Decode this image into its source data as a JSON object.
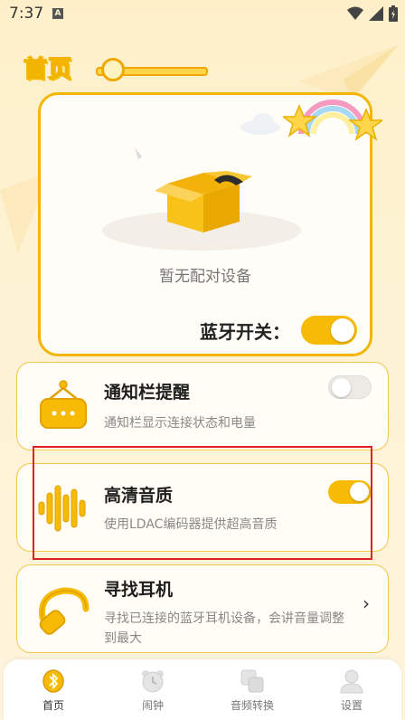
{
  "status_bar": {
    "time": "7:37",
    "notification_letter": "A"
  },
  "header": {
    "title": "首页"
  },
  "hero": {
    "empty_text": "暂无配对设备",
    "bluetooth_label": "蓝牙开关：",
    "bluetooth_on": true
  },
  "features": [
    {
      "title": "通知栏提醒",
      "desc": "通知栏显示连接状态和电量",
      "enabled": false
    },
    {
      "title": "高清音质",
      "desc": "使用LDAC编码器提供超高音质",
      "enabled": true
    },
    {
      "title": "寻找耳机",
      "desc": "寻找已连接的蓝牙耳机设备，会讲音量调整到最大",
      "chevron": "›"
    }
  ],
  "tabs": [
    {
      "label": "首页",
      "icon": "bluetooth-icon",
      "active": true
    },
    {
      "label": "闹钟",
      "icon": "alarm-clock-icon",
      "active": false
    },
    {
      "label": "音频转换",
      "icon": "audio-convert-icon",
      "active": false
    },
    {
      "label": "设置",
      "icon": "user-settings-icon",
      "active": false
    }
  ],
  "colors": {
    "accent": "#f7bb05",
    "highlight": "#e02020",
    "background": "#fdf0c9"
  }
}
